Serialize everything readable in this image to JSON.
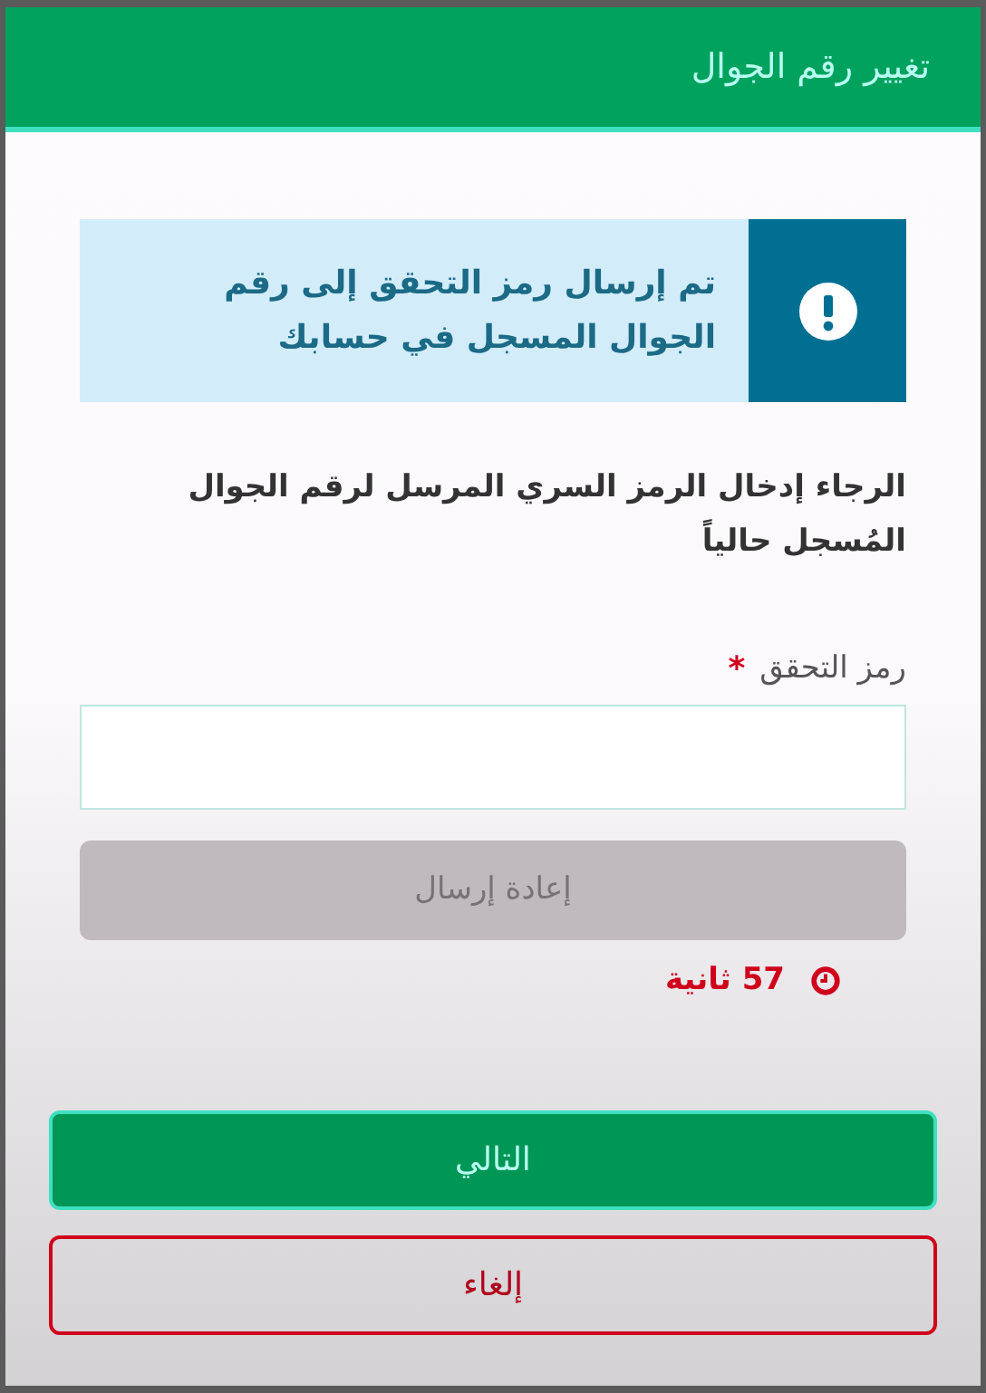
{
  "dialog": {
    "title": "تغيير رقم الجوال"
  },
  "alert": {
    "text": "تم إرسال رمز التحقق إلى رقم الجوال المسجل في حسابك"
  },
  "instruction": "الرجاء إدخال الرمز السري المرسل لرقم الجوال المُسجل حالياً",
  "field": {
    "label": "رمز التحقق",
    "required_mark": "*"
  },
  "resend_button": {
    "label": "إعادة إرسال",
    "disabled": true
  },
  "timer": {
    "text": "57 ثانية"
  },
  "buttons": [
    {
      "kind": "primary",
      "label": "التالي"
    },
    {
      "kind": "cancel",
      "label": "إلغاء"
    }
  ]
}
